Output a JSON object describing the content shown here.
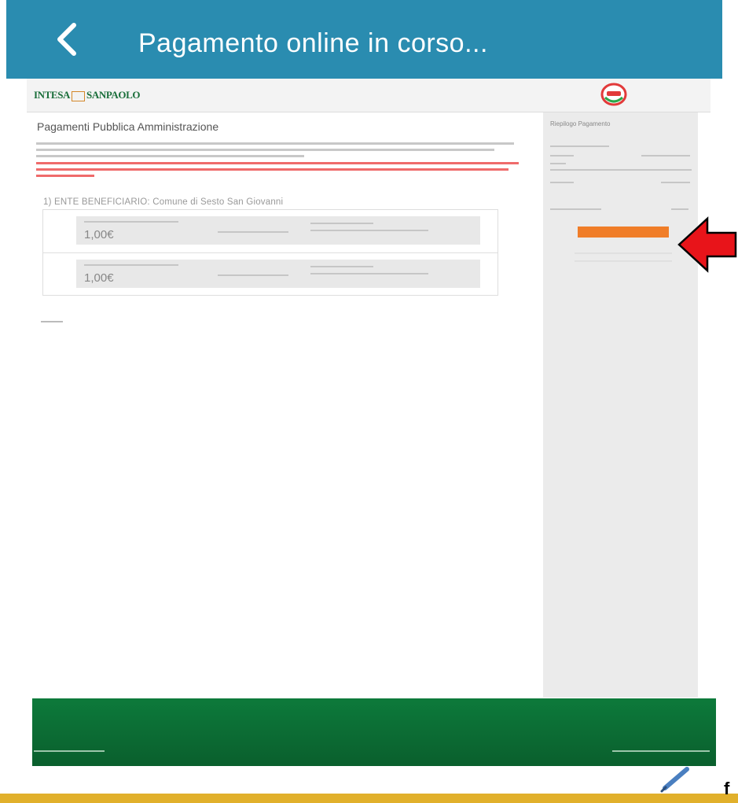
{
  "app_bar": {
    "title": "Pagamento online in corso...",
    "background": "#2a8cb0"
  },
  "bank_header": {
    "logo_text_left": "INTESA",
    "logo_text_right": "SANPAOLO",
    "pa_logo_icon": "pagopa-logo"
  },
  "main": {
    "heading": "Pagamenti Pubblica Amministrazione",
    "ente_label": "1) ENTE BENEFICIARIO: Comune di Sesto San Giovanni",
    "payments": [
      {
        "amount": "1,00€"
      },
      {
        "amount": "1,00€"
      }
    ]
  },
  "sidebar": {
    "title": "Riepilogo Pagamento"
  },
  "colors": {
    "accent_orange": "#f07d28",
    "warning_red": "#e03b3b",
    "footer_green": "#0d7a3b",
    "annotation_arrow": "#e8141a"
  },
  "icons": {
    "back": "back-arrow-icon",
    "annotation": "red-pointer-arrow-icon",
    "edit": "pencil-icon"
  },
  "crop_fragment": "f"
}
